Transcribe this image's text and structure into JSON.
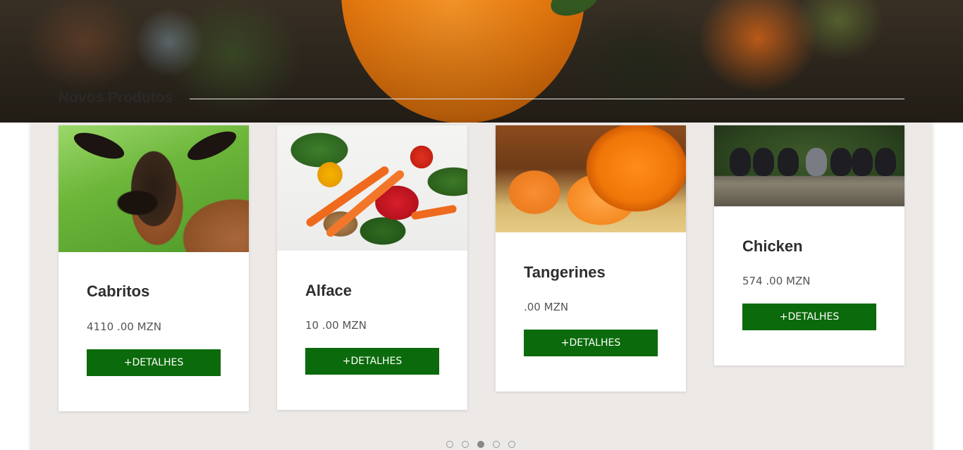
{
  "section": {
    "title": "Novos Produtos"
  },
  "products": [
    {
      "name": "Cabritos",
      "price": "4110 .00 MZN",
      "button": "+DETALHES",
      "image": "goat-photo"
    },
    {
      "name": "Alface",
      "price": "10 .00 MZN",
      "button": "+DETALHES",
      "image": "vegetables-photo"
    },
    {
      "name": "Tangerines",
      "price": ".00 MZN",
      "button": "+DETALHES",
      "image": "tangerines-photo"
    },
    {
      "name": "Chicken",
      "price": "574 .00 MZN",
      "button": "+DETALHES",
      "image": "chickens-photo"
    }
  ],
  "carousel": {
    "pages": 5,
    "active_page": 3
  },
  "colors": {
    "button": "#0b6a0b",
    "panel": "#ece9e7",
    "card": "#ffffff"
  }
}
